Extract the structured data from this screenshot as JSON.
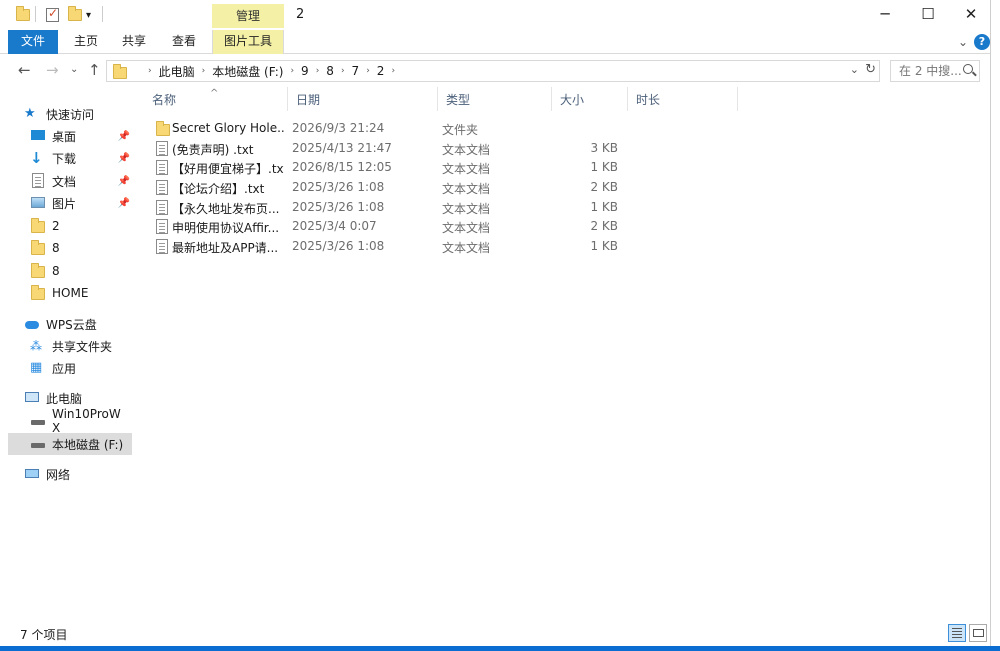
{
  "window": {
    "title": "2",
    "context_tab": "管理",
    "minimize_glyph": "─",
    "maximize_glyph": "☐",
    "close_glyph": "✕"
  },
  "ribbon": {
    "tabs": [
      "文件",
      "主页",
      "共享",
      "查看",
      "图片工具"
    ],
    "collapse_glyph": "⌄",
    "help_glyph": "?"
  },
  "address": {
    "back_glyph": "←",
    "forward_glyph": "→",
    "recent_glyph": "⌄",
    "up_glyph": "↑",
    "crumbs": [
      "此电脑",
      "本地磁盘 (F:)",
      "9",
      "8",
      "7",
      "2"
    ],
    "crumb_separator": "›",
    "dropdown_glyph": "⌄",
    "refresh_glyph": "↻",
    "search_placeholder": "在 2 中搜..."
  },
  "nav": {
    "pin_glyph": "📌",
    "items": [
      {
        "label": "快速访问",
        "icon": "star-icon"
      },
      {
        "label": "桌面",
        "icon": "desktop-icon",
        "pinned": true
      },
      {
        "label": "下载",
        "icon": "download-icon",
        "pinned": true
      },
      {
        "label": "文档",
        "icon": "document-icon",
        "pinned": true
      },
      {
        "label": "图片",
        "icon": "picture-icon",
        "pinned": true
      },
      {
        "label": "2",
        "icon": "folder-icon"
      },
      {
        "label": "8",
        "icon": "folder-icon"
      },
      {
        "label": "8",
        "icon": "folder-icon"
      },
      {
        "label": "HOME",
        "icon": "folder-icon"
      },
      {
        "label": "WPS云盘",
        "icon": "cloud-icon"
      },
      {
        "label": "共享文件夹",
        "icon": "share-icon"
      },
      {
        "label": "应用",
        "icon": "apps-icon"
      },
      {
        "label": "此电脑",
        "icon": "computer-icon"
      },
      {
        "label": "Win10ProW X",
        "icon": "drive-icon"
      },
      {
        "label": "本地磁盘 (F:)",
        "icon": "drive-icon",
        "selected": true
      },
      {
        "label": "网络",
        "icon": "network-icon"
      }
    ]
  },
  "columns": {
    "name": "名称",
    "date": "日期",
    "type": "类型",
    "size": "大小",
    "duration": "时长",
    "sort_glyph": "^"
  },
  "files": [
    {
      "name": "Secret Glory Hole...",
      "date": "2026/9/3 21:24",
      "type": "文件夹",
      "size": "",
      "icon": "folder-icon"
    },
    {
      "name": "(免责声明) .txt",
      "date": "2025/4/13 21:47",
      "type": "文本文档",
      "size": "3 KB",
      "icon": "text-file-icon"
    },
    {
      "name": "【好用便宜梯子】.txt",
      "date": "2026/8/15 12:05",
      "type": "文本文档",
      "size": "1 KB",
      "icon": "text-file-icon"
    },
    {
      "name": "【论坛介绍】.txt",
      "date": "2025/3/26 1:08",
      "type": "文本文档",
      "size": "2 KB",
      "icon": "text-file-icon"
    },
    {
      "name": "【永久地址发布页...",
      "date": "2025/3/26 1:08",
      "type": "文本文档",
      "size": "1 KB",
      "icon": "text-file-icon"
    },
    {
      "name": "申明使用协议Affir...",
      "date": "2025/3/4 0:07",
      "type": "文本文档",
      "size": "2 KB",
      "icon": "text-file-icon"
    },
    {
      "name": "最新地址及APP请...",
      "date": "2025/3/26 1:08",
      "type": "文本文档",
      "size": "1 KB",
      "icon": "text-file-icon"
    }
  ],
  "status": {
    "count": "7 个项目"
  },
  "colors": {
    "accent": "#1979ca",
    "context_tab": "#f4f1a6",
    "folder": "#f8d775",
    "selected": "#dcdcdc"
  }
}
